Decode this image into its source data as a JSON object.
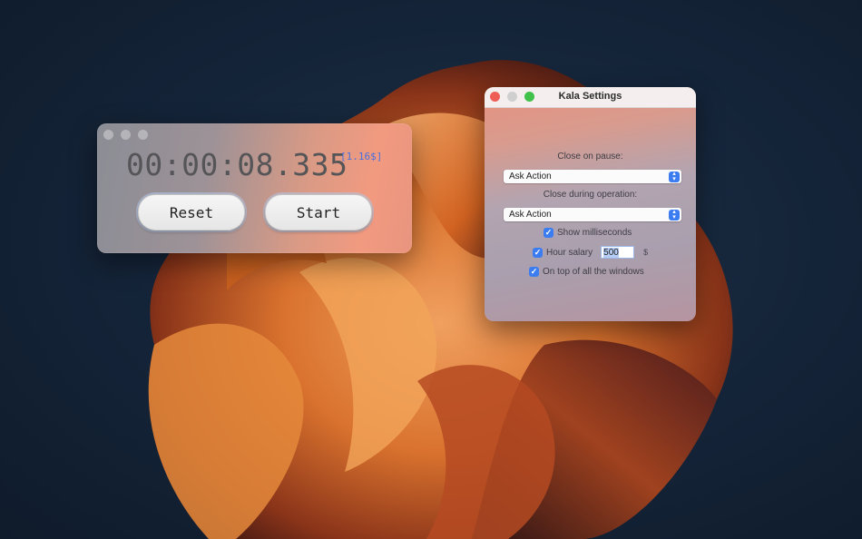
{
  "timer": {
    "display": "00:00:08.335",
    "salary_badge": "[1.16$]",
    "reset_label": "Reset",
    "start_label": "Start"
  },
  "settings": {
    "title": "Kala Settings",
    "close_on_pause_label": "Close on pause:",
    "close_on_pause_value": "Ask Action",
    "close_during_operation_label": "Close during operation:",
    "close_during_operation_value": "Ask Action",
    "show_milliseconds_label": "Show milliseconds",
    "show_milliseconds_checked": true,
    "hour_salary_label": "Hour salary",
    "hour_salary_value": "500",
    "hour_salary_currency": "$",
    "hour_salary_checked": true,
    "on_top_label": "On top of all the windows",
    "on_top_checked": true
  },
  "colors": {
    "accent": "#3b7cf0",
    "close_button": "#ee5e57",
    "zoom_button": "#3fc14a",
    "salary_badge": "#4a70e0"
  },
  "icons": {
    "checkbox": "checkmark-icon",
    "select": "chevron-up-down-icon"
  }
}
